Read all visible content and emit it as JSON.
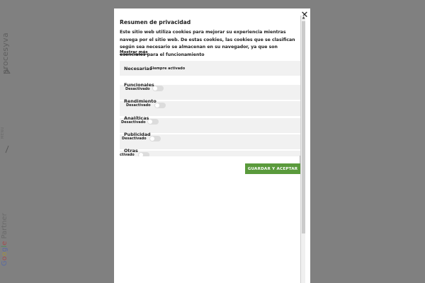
{
  "site": {
    "logo_text": "procesyva",
    "menu_label": "MENU",
    "partner_parts": [
      "G",
      "o",
      "o",
      "g",
      "l",
      "e",
      " Partner"
    ]
  },
  "modal": {
    "title": "Resumen de privacidad",
    "description": "Este sitio web utiliza cookies para mejorar su experiencia mientras navega por el sitio web. De estas cookies, las cookies que se clasifican según sea necesario se almacenan en su navegador, ya que son esenciales para el funcionamiento",
    "show_more": "Mostrar más",
    "categories": [
      {
        "name": "Necesarias",
        "status": "Siempre activado",
        "has_toggle": false
      },
      {
        "name": "Funcionales",
        "status": "Desactivado",
        "has_toggle": true
      },
      {
        "name": "Rendimiento",
        "status": "Desactivado",
        "has_toggle": true
      },
      {
        "name": "Analíticas",
        "status": "Desactivado",
        "has_toggle": true
      },
      {
        "name": "Publicidad",
        "status": "Desactivado",
        "has_toggle": true
      },
      {
        "name": "Otras",
        "status": "ctivado",
        "has_toggle": true
      }
    ],
    "save_label": "GUARDAR Y ACEPTAR",
    "close_icon": "close-icon",
    "accent_color": "#5a9a3c"
  }
}
